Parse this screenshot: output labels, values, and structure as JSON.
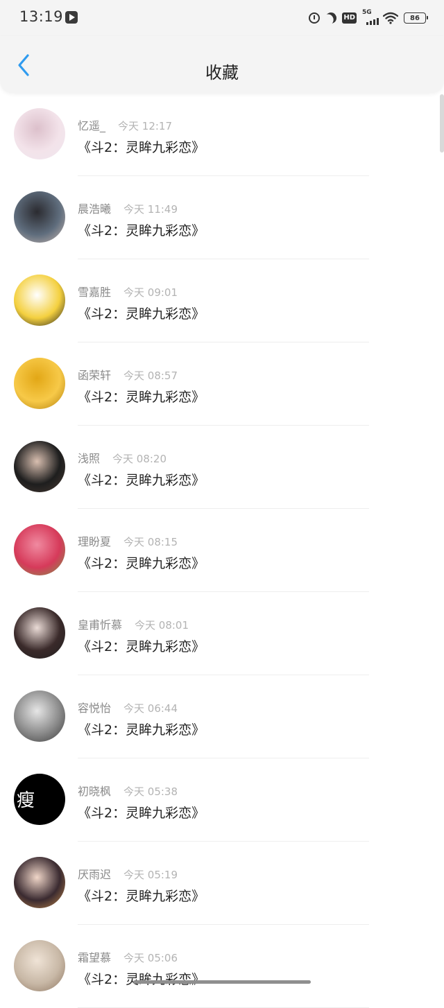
{
  "status_bar": {
    "time": "13:19",
    "network": "5G",
    "hd": "HD",
    "battery": "86"
  },
  "header": {
    "title": "收藏"
  },
  "items": [
    {
      "author": "忆遥_",
      "time": "今天 12:17",
      "title": "《斗2：灵眸九彩恋》",
      "avatar_colors": [
        "#f3e3ea",
        "#dcc0cb",
        "#efe7ee"
      ]
    },
    {
      "author": "晨浩曦",
      "time": "今天 11:49",
      "title": "《斗2：灵眸九彩恋》",
      "avatar_colors": [
        "#5f6d7d",
        "#2b2b30",
        "#c9b8b0"
      ]
    },
    {
      "author": "雪嘉胜",
      "time": "今天 09:01",
      "title": "《斗2：灵眸九彩恋》",
      "avatar_colors": [
        "#f4d03f",
        "#ffffff",
        "#1a1a1a"
      ]
    },
    {
      "author": "函荣轩",
      "time": "今天 08:57",
      "title": "《斗2：灵眸九彩恋》",
      "avatar_colors": [
        "#f7c948",
        "#e2a716",
        "#b07d0a"
      ]
    },
    {
      "author": "浅照",
      "time": "今天 08:20",
      "title": "《斗2：灵眸九彩恋》",
      "avatar_colors": [
        "#1e1e1e",
        "#d9bfb0",
        "#4a3b33"
      ]
    },
    {
      "author": "理盼夏",
      "time": "今天 08:15",
      "title": "《斗2：灵眸九彩恋》",
      "avatar_colors": [
        "#d63a5a",
        "#f08aa0",
        "#7a9a4a"
      ]
    },
    {
      "author": "皇甫忻慕",
      "time": "今天 08:01",
      "title": "《斗2：灵眸九彩恋》",
      "avatar_colors": [
        "#3a2a2a",
        "#eadbd6",
        "#1f1f1f"
      ]
    },
    {
      "author": "容悦怡",
      "time": "今天 06:44",
      "title": "《斗2：灵眸九彩恋》",
      "avatar_colors": [
        "#8a8a8a",
        "#e6e6e6",
        "#3a3a3a"
      ]
    },
    {
      "author": "初晓枫",
      "time": "今天 05:38",
      "title": "《斗2：灵眸九彩恋》",
      "avatar_colors": [
        "#000000",
        "#000000",
        "#000000"
      ],
      "avatar_text": "瘦"
    },
    {
      "author": "厌雨迟",
      "time": "今天 05:19",
      "title": "《斗2：灵眸九彩恋》",
      "avatar_colors": [
        "#3a2a30",
        "#f0d6c8",
        "#c48a4a"
      ]
    },
    {
      "author": "霜望慕",
      "time": "今天 05:06",
      "title": "《斗2：灵眸九彩恋》",
      "avatar_colors": [
        "#c8b8a6",
        "#efe3d6",
        "#8d7560"
      ]
    }
  ]
}
